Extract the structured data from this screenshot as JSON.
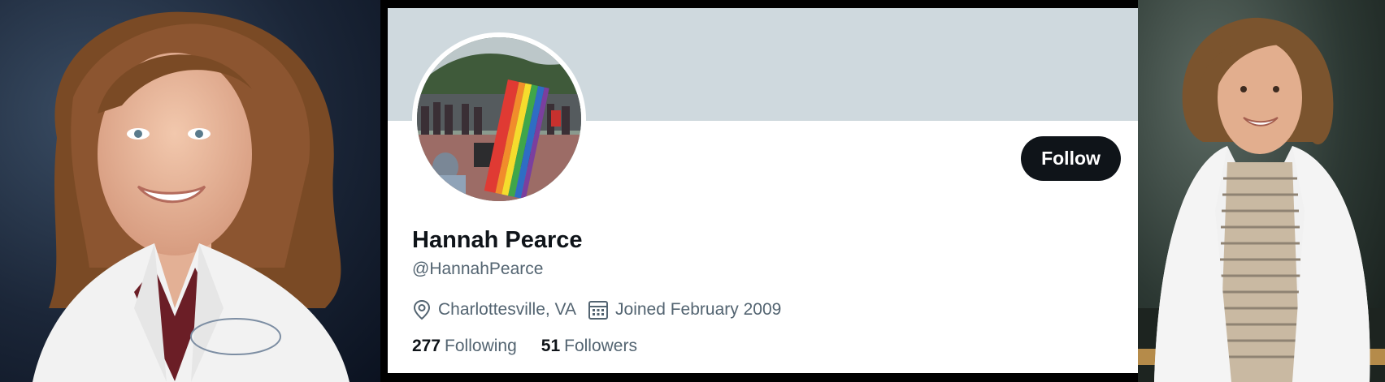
{
  "profile": {
    "display_name": "Hannah Pearce",
    "handle": "@HannahPearce",
    "location": "Charlottesville, VA",
    "joined": "Joined February 2009",
    "following_count": "277",
    "following_label": "Following",
    "followers_count": "51",
    "followers_label": "Followers",
    "follow_label": "Follow"
  },
  "icons": {
    "location": "location-pin-icon",
    "calendar": "calendar-icon"
  },
  "colors": {
    "banner": "#cfd9de",
    "button": "#0f1419",
    "secondary_text": "#536471"
  }
}
